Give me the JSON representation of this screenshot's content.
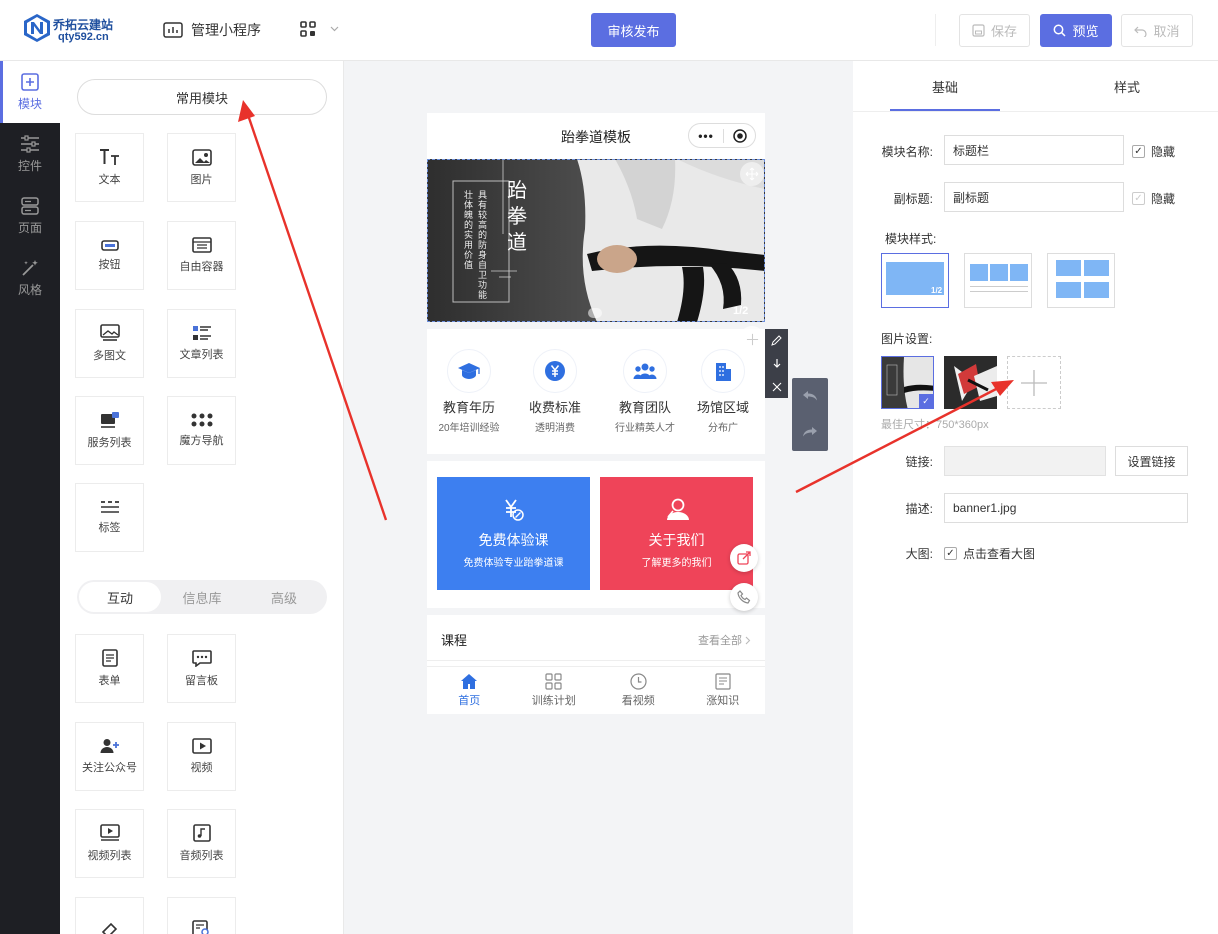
{
  "brand": {
    "name": "乔拓云建站",
    "url": "qty592.cn"
  },
  "topbar": {
    "manage_label": "管理小程序",
    "publish_label": "审核发布",
    "save_label": "保存",
    "preview_label": "预览",
    "cancel_label": "取消"
  },
  "rail": [
    {
      "label": "模块",
      "icon": "plus-square-icon"
    },
    {
      "label": "控件",
      "icon": "sliders-icon"
    },
    {
      "label": "页面",
      "icon": "pages-icon"
    },
    {
      "label": "风格",
      "icon": "magic-wand-icon"
    }
  ],
  "modules": {
    "common_label": "常用模块",
    "common": [
      {
        "label": "文本",
        "icon": "text-icon"
      },
      {
        "label": "图片",
        "icon": "image-icon"
      },
      {
        "label": "按钮",
        "icon": "button-icon"
      },
      {
        "label": "自由容器",
        "icon": "container-icon"
      },
      {
        "label": "多图文",
        "icon": "multi-image-icon"
      },
      {
        "label": "文章列表",
        "icon": "article-list-icon"
      },
      {
        "label": "服务列表",
        "icon": "service-list-icon"
      },
      {
        "label": "魔方导航",
        "icon": "cube-nav-icon"
      },
      {
        "label": "标签",
        "icon": "tag-icon"
      }
    ],
    "tabs": [
      "互动",
      "信息库",
      "高级"
    ],
    "interactive": [
      {
        "label": "表单",
        "icon": "form-icon"
      },
      {
        "label": "留言板",
        "icon": "message-board-icon"
      },
      {
        "label": "关注公众号",
        "icon": "follow-icon"
      },
      {
        "label": "视频",
        "icon": "video-icon"
      },
      {
        "label": "视频列表",
        "icon": "video-list-icon"
      },
      {
        "label": "音频列表",
        "icon": "audio-list-icon"
      },
      {
        "label": "",
        "icon": "eraser-icon"
      },
      {
        "label": "",
        "icon": "search-list-icon"
      }
    ]
  },
  "phone": {
    "title": "跆拳道模板",
    "capsule_dots": "•••",
    "banner": {
      "title_chars": [
        "跆",
        "拳",
        "道"
      ],
      "vertical_text_1": "具有较高的防身自卫功能",
      "vertical_text_2": "壮体魄的实用价值",
      "counter": "1/2"
    },
    "nav": [
      {
        "label": "教育年历",
        "sub": "20年培训经验",
        "icon": "graduation-cap-icon"
      },
      {
        "label": "收费标准",
        "sub": "透明消费",
        "icon": "yen-icon"
      },
      {
        "label": "教育团队",
        "sub": "行业精英人才",
        "icon": "team-icon"
      },
      {
        "label": "场馆区域",
        "sub": "分布广",
        "icon": "building-icon"
      }
    ],
    "cards": [
      {
        "title": "免费体验课",
        "sub": "免费体验专业跆拳道课",
        "color": "#3d7ff0"
      },
      {
        "title": "关于我们",
        "sub": "了解更多的我们",
        "color": "#ef4459"
      }
    ],
    "course": {
      "title": "课程",
      "more": "查看全部"
    },
    "tabbar": [
      {
        "label": "首页",
        "icon": "home-icon"
      },
      {
        "label": "训练计划",
        "icon": "grid-icon"
      },
      {
        "label": "看视频",
        "icon": "clock-icon"
      },
      {
        "label": "涨知识",
        "icon": "document-icon"
      }
    ]
  },
  "right": {
    "tabs": [
      "基础",
      "样式"
    ],
    "module_name_label": "模块名称:",
    "module_name_value": "标题栏",
    "subtitle_label": "副标题:",
    "subtitle_value": "副标题",
    "hide_label": "隐藏",
    "style_label": "模块样式:",
    "style_badge": "1/2",
    "image_label": "图片设置:",
    "size_hint": "最佳尺寸：750*360px",
    "link_label": "链接:",
    "link_button": "设置链接",
    "desc_label": "描述:",
    "desc_value": "banner1.jpg",
    "bigimg_label": "大图:",
    "bigimg_check": "点击查看大图"
  },
  "colors": {
    "accent": "#5b6ee1",
    "arrow": "#e8322b",
    "rail": "#1e1f24"
  }
}
